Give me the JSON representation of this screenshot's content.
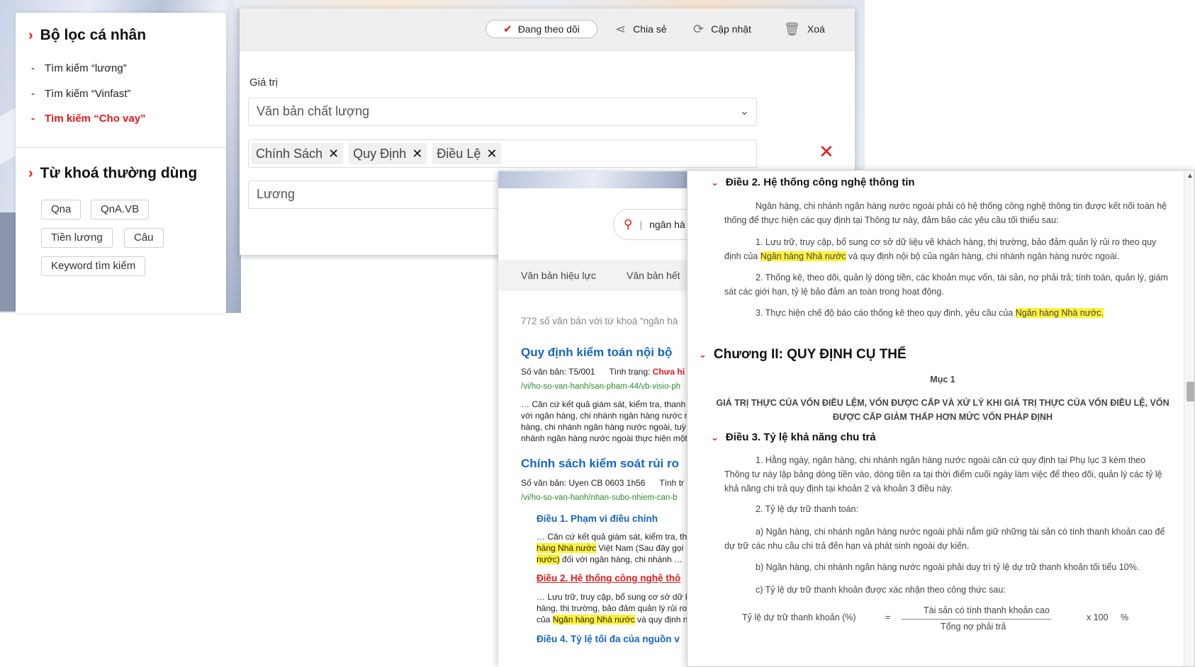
{
  "filter_panel": {
    "personal_filter_title": "Bộ lọc cá nhân",
    "personal_items": [
      {
        "bullet": "-",
        "label": "Tìm kiếm “lương”"
      },
      {
        "bullet": "-",
        "label": "Tìm kiếm “Vinfast”"
      },
      {
        "bullet": "-",
        "label": "Tìm kiếm “Cho vay”"
      }
    ],
    "keywords_title": "Từ khoá thường dùng",
    "keywords": [
      "Qna",
      "QnA.VB",
      "Tiền lương",
      "Câu",
      "Keyword tìm kiếm"
    ]
  },
  "form_panel": {
    "toolbar": {
      "follow_label": "Đang theo dõi",
      "share_label": "Chia sẻ",
      "update_label": "Cập nhật",
      "delete_label": "Xoá"
    },
    "value_label": "Giá trị",
    "select_value": "Văn bản chất lượng",
    "tags": [
      "Chính Sách",
      "Quy Định",
      "Điều Lệ"
    ],
    "keyword_value": "Lương"
  },
  "results_panel": {
    "search_value": "ngân hà",
    "tabs": [
      "Văn bản hiệu lực",
      "Văn bản hết"
    ],
    "count_text": "772 số văn bản với từ khoá “ngân hà",
    "result1": {
      "title": "Quy định kiểm toán nội bộ",
      "meta_prefix": "Số văn bản: T5/001      Tình trạng: ",
      "meta_status": "Chưa hi",
      "link": "/vi/ho-so-van-hanh/san-pham-44/vb-visio-ph",
      "snippet": [
        "… Căn cứ kết quả giám sát, kiểm tra, thanh",
        "với ngân hàng, chi nhánh ngân hàng nước n",
        "hàng, chi nhánh ngân hàng nước ngoài, tuỳ",
        "nhánh ngân hàng nước ngoài thực hiện một"
      ]
    },
    "result2": {
      "title": "Chính sách kiểm soát rủi ro",
      "meta": "Số văn bản: Uyen CB 0603 1h56      Tình tr",
      "link": "/vi/ho-so-van-hanh/nhan-subo-nhiem-can-b",
      "sub1_title": "Điều 1. Phạm vi điều chỉnh",
      "sub1_lines": [
        "… Căn cứ kết quả giám sát, kiểm tra, th",
        "hàng Nhà nước",
        " Việt Nam (Sau đây gọi",
        "nước)",
        " đối với ngân hàng, chi nhánh …"
      ],
      "sub2_title": "Điều 2. Hệ thống công nghệ thô",
      "sub2_lines": [
        "… Lưu trữ, truy cập, bổ sung cơ sở dữ li",
        "hàng, thị trường, bảo đảm quản lý rủi ro",
        "của ",
        "Ngân hàng Nhà nước",
        " và quy định n"
      ],
      "sub3_title": "Điều 4. Tỷ lệ tối đa của nguồn v"
    }
  },
  "document_panel": {
    "article2_title": "Điều 2. Hệ thống công nghệ thông tin",
    "article2_intro": "Ngân hàng, chi nhánh ngân hàng nước ngoài phải có hệ thống công nghệ thông tin được kết nối toàn hệ thống để thực hiện các quy định tại Thông tư này, đảm bảo các yêu cầu tối thiểu sau:",
    "article2_p1_a": "1. Lưu trữ, truy cập, bổ sung cơ sở dữ liệu về khách hàng, thị trường, bảo đảm quản lý rủi ro theo quy định của ",
    "article2_p1_hl": "Ngân hàng Nhà nước",
    "article2_p1_b": " và quy định nội bộ của ngân hàng, chi nhánh ngân hàng nước ngoài.",
    "article2_p2": "2. Thống kê, theo dõi, quản lý dòng tiền, các khoản mục vốn, tài sản, nợ phải trả; tính toán, quản lý, giám sát các giới hạn, tỷ lệ bảo đảm an toàn trong hoạt động.",
    "article2_p3_a": "3. Thực hiện chế độ báo cáo thống kê theo quy định, yêu cầu của ",
    "article2_p3_hl": "Ngân hàng Nhà nước.",
    "chapter2_title": "Chương II: QUY ĐỊNH CỤ THỂ",
    "section1": "Mục 1",
    "section1_heading": "GIÁ TRỊ THỰC CỦA VỐN ĐIỀU LỆM, VỐN ĐƯỢC CẤP VÀ XỬ LÝ KHI GIÁ TRỊ THỰC CỦA VỐN ĐIỀU LỆ, VỐN ĐƯỢC CẤP GIẢM THẤP HƠN MỨC VỐN PHÁP ĐỊNH",
    "article3_title": "Điều 3. Tỷ lệ khả năng chu trả",
    "article3_p1": "1. Hằng ngày, ngân hàng, chi nhánh ngân hàng nước ngoài căn cứ quy định tại Phụ lục 3 kèm theo Thông tư này lập bảng dòng tiền vào, dòng tiền ra tại thời điểm cuối ngày làm việc để theo dõi, quản lý các tỷ lệ khả năng chi trả quy định tại khoản 2 và khoản 3 điều này.",
    "article3_p2": "2. Tỷ lệ dự trữ thanh toán:",
    "article3_p2a": "a) Ngân hàng, chi nhánh ngân hàng nước ngoài phải nắm giữ những tài sản có tính thanh khoản cao để dự trữ các nhu cầu chi trả đến hạn và phát sinh ngoài dự kiến.",
    "article3_p2b": "b) Ngân hàng, chi nhánh ngân hàng nước ngoài phải duy trì tỷ lệ dự trữ thanh khoản tối tiểu 10%.",
    "article3_p2c": "c) Tỷ lệ dự trữ thanh khoản được xác nhận theo công thức sau:",
    "formula_left": "Tỷ lệ dự trữ thanh khoản (%)",
    "formula_eq": "=",
    "formula_num": "Tài sản có tính thanh khoản cao",
    "formula_den": "Tổng nợ phải trả",
    "formula_mult": "x 100",
    "formula_pct": "%"
  },
  "colors": {
    "accent_red": "#e21b1b",
    "link_blue": "#1565c0",
    "link_green": "#2e8b2e",
    "highlight": "#fff23a"
  }
}
